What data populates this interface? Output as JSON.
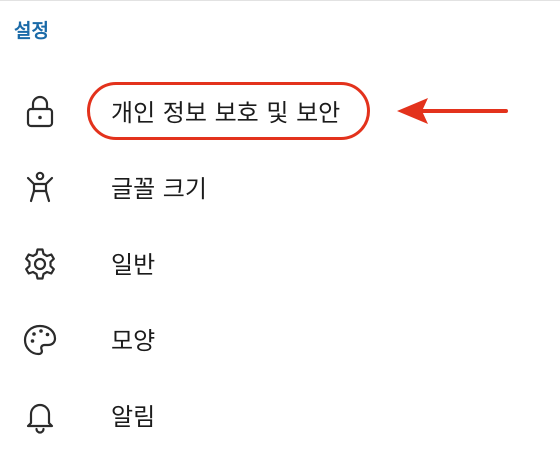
{
  "header": {
    "title": "설정"
  },
  "menu": [
    {
      "label": "개인 정보 보호 및 보안",
      "icon": "lock-icon"
    },
    {
      "label": "글꼴 크기",
      "icon": "accessibility-person-icon"
    },
    {
      "label": "일반",
      "icon": "gear-icon"
    },
    {
      "label": "모양",
      "icon": "palette-icon"
    },
    {
      "label": "알림",
      "icon": "bell-icon"
    }
  ],
  "annotation": {
    "highlight_color": "#e3321c",
    "arrow_icon": "left-arrow-icon"
  },
  "colors": {
    "title": "#1a6aa8",
    "text": "#1b1b1b",
    "icon": "#2b2b2b"
  }
}
